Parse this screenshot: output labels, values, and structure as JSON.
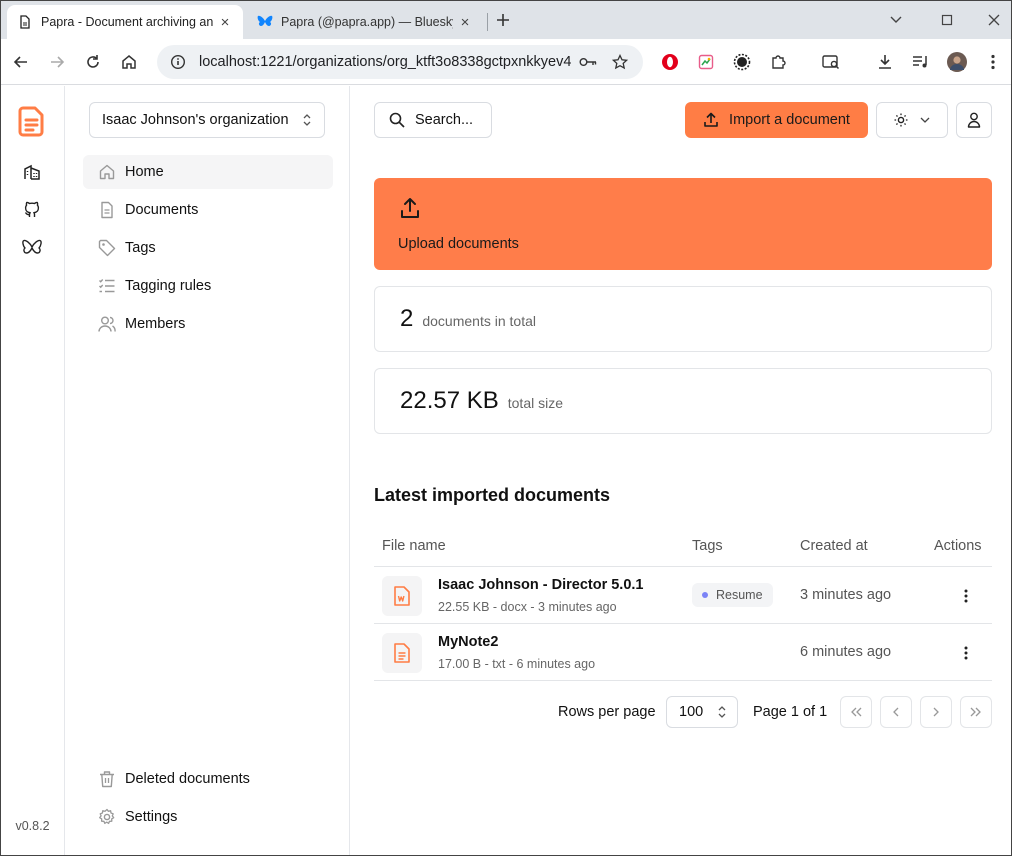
{
  "browser": {
    "tabs": [
      {
        "title": "Papra - Document archiving and management",
        "active": true
      },
      {
        "title": "Papra (@papra.app) — Bluesky",
        "active": false
      }
    ],
    "url": "localhost:1221/organizations/org_ktft3o8338gctpxnkkyev4..."
  },
  "app": {
    "version": "v0.8.2",
    "accent_color": "#ff7d45",
    "organization": "Isaac Johnson's organization",
    "nav": {
      "home": "Home",
      "documents": "Documents",
      "tags": "Tags",
      "tagging_rules": "Tagging rules",
      "members": "Members",
      "deleted": "Deleted documents",
      "settings": "Settings"
    },
    "header": {
      "search": "Search...",
      "import": "Import a document"
    },
    "upload_card": {
      "label": "Upload documents"
    },
    "stats": {
      "documents_count": "2",
      "documents_label": "documents in total",
      "size_value": "22.57 KB",
      "size_label": "total size"
    },
    "latest": {
      "title": "Latest imported documents",
      "columns": {
        "file": "File name",
        "tags": "Tags",
        "created": "Created at",
        "actions": "Actions"
      },
      "rows": [
        {
          "name": "Isaac Johnson - Director 5.0.1",
          "meta": "22.55 KB - docx - 3 minutes ago",
          "tag": "Resume",
          "tag_color": "#7b83f6",
          "created": "3 minutes ago"
        },
        {
          "name": "MyNote2",
          "meta": "17.00 B - txt - 6 minutes ago",
          "tag": "",
          "created": "6 minutes ago"
        }
      ]
    },
    "pagination": {
      "rows_per_page_label": "Rows per page",
      "rows_per_page": "100",
      "page_info": "Page 1 of 1"
    }
  }
}
